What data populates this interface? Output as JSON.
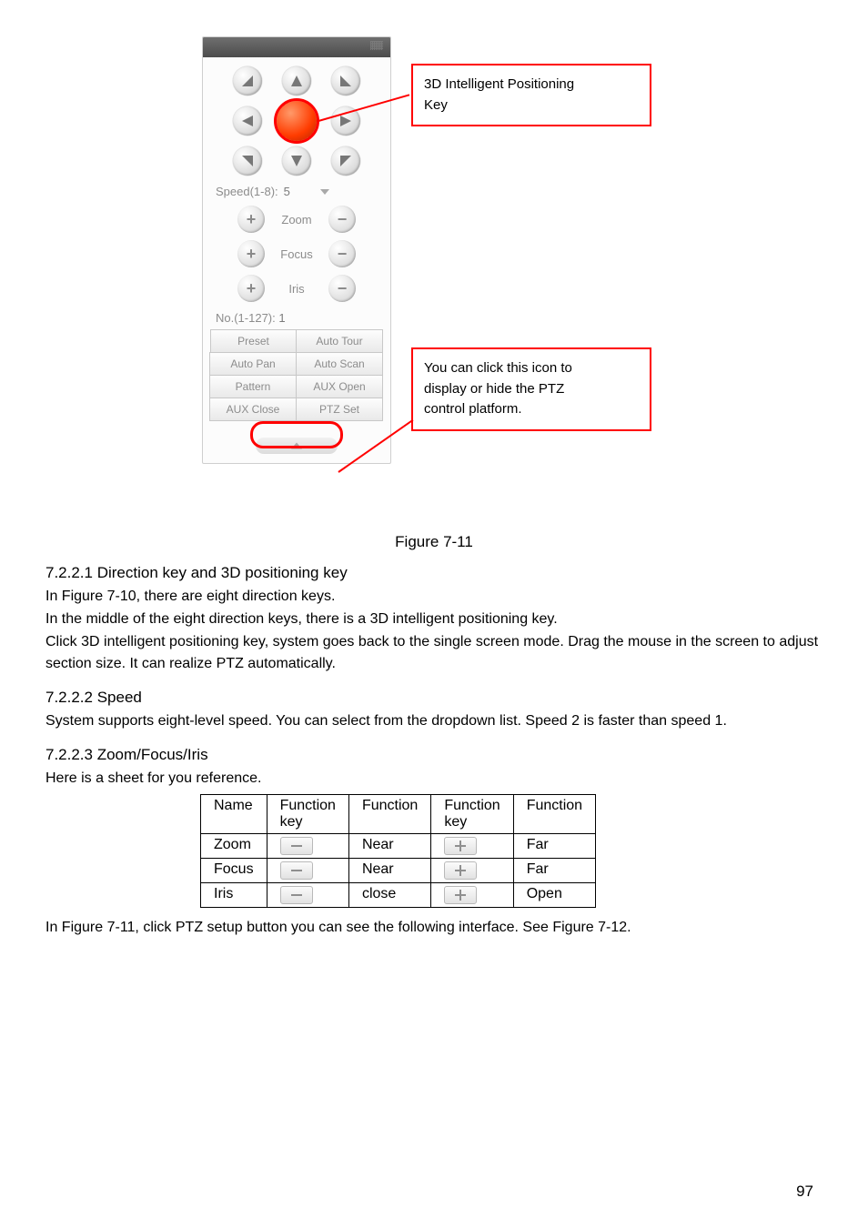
{
  "figure": {
    "caption": "Figure 7-11",
    "callouts": {
      "c1_line1": "3D Intelligent Positioning",
      "c1_line2": "Key",
      "c2_line1": "You can click this icon to",
      "c2_line2": "display or hide the PTZ",
      "c2_line3": "control platform."
    },
    "panel": {
      "speed_label": "Speed(1-8):",
      "speed_value": "5",
      "zoom_label": "Zoom",
      "focus_label": "Focus",
      "iris_label": "Iris",
      "no_label": "No.(1-127):",
      "no_value": "1",
      "buttons": {
        "preset": "Preset",
        "auto_tour": "Auto Tour",
        "auto_pan": "Auto Pan",
        "auto_scan": "Auto Scan",
        "pattern": "Pattern",
        "aux_open": "AUX Open",
        "aux_close": "AUX Close",
        "ptz_set": "PTZ Set"
      }
    }
  },
  "sections": {
    "s1_title": "7.2.2.1  Direction key and 3D positioning key",
    "s1_p1": "In Figure 7-10, there are eight direction keys.",
    "s1_p2": "In the middle of the eight direction keys, there is a 3D intelligent positioning key.",
    "s1_p3": "Click 3D intelligent positioning key, system goes back to the single screen mode. Drag the mouse in the screen to adjust section size. It can realize PTZ automatically.",
    "s2_title": "7.2.2.2  Speed",
    "s2_p1": "System supports eight-level speed. You can select from the dropdown list. Speed 2 is faster than speed 1.",
    "s3_title": "7.2.2.3  Zoom/Focus/Iris",
    "s3_p1": "Here is a sheet for you reference.",
    "after_table": "In Figure 7-11, click PTZ setup button you can see the following interface. See Figure 7-12."
  },
  "table": {
    "headers": {
      "name": "Name",
      "fk1": "Function key",
      "f1": "Function",
      "fk2": "Function key",
      "f2": "Function"
    },
    "rows": [
      {
        "name": "Zoom",
        "f1": "Near",
        "f2": "Far"
      },
      {
        "name": "Focus",
        "f1": "Near",
        "f2": "Far"
      },
      {
        "name": "Iris",
        "f1": "close",
        "f2": "Open"
      }
    ]
  },
  "page_number": "97"
}
